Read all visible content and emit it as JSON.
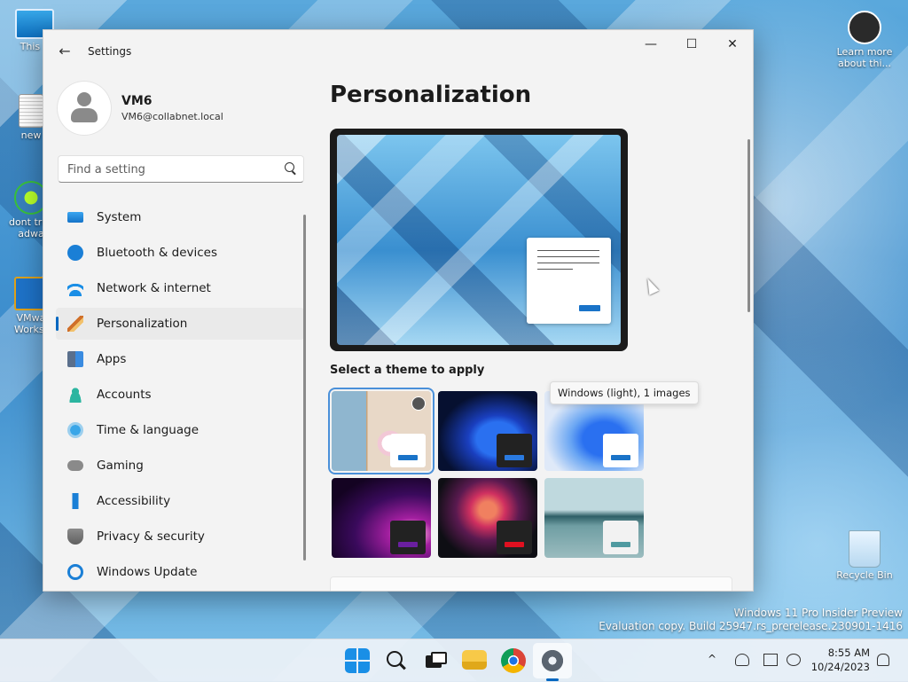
{
  "desktop": {
    "icons": [
      {
        "label": "This P"
      },
      {
        "label": "new"
      },
      {
        "label": "dont trus adwa"
      },
      {
        "label": "VMwa Workst"
      },
      {
        "label": "Learn more about thi..."
      },
      {
        "label": "Recycle Bin"
      }
    ],
    "watermark": {
      "line1": "Windows 11 Pro Insider Preview",
      "line2": "Evaluation copy. Build 25947.rs_prerelease.230901-1416"
    }
  },
  "window": {
    "title": "Settings",
    "controls": {
      "minimize": "—",
      "maximize": "☐",
      "close": "✕"
    },
    "back_glyph": "←"
  },
  "profile": {
    "name": "VM6",
    "email": "VM6@collabnet.local"
  },
  "search": {
    "placeholder": "Find a setting"
  },
  "nav": {
    "items": [
      {
        "label": "System",
        "icon": "system-icon"
      },
      {
        "label": "Bluetooth & devices",
        "icon": "bluetooth-icon"
      },
      {
        "label": "Network & internet",
        "icon": "wifi-icon"
      },
      {
        "label": "Personalization",
        "icon": "brush-icon",
        "active": true
      },
      {
        "label": "Apps",
        "icon": "apps-icon"
      },
      {
        "label": "Accounts",
        "icon": "account-icon"
      },
      {
        "label": "Time & language",
        "icon": "globe-clock-icon"
      },
      {
        "label": "Gaming",
        "icon": "controller-icon"
      },
      {
        "label": "Accessibility",
        "icon": "accessibility-icon"
      },
      {
        "label": "Privacy & security",
        "icon": "shield-icon"
      },
      {
        "label": "Windows Update",
        "icon": "update-icon"
      }
    ]
  },
  "main": {
    "page_title": "Personalization",
    "theme_heading": "Select a theme to apply",
    "tooltip": "Windows (light), 1 images",
    "themes": [
      {
        "name": "theme-spotlight",
        "selected": true
      },
      {
        "name": "theme-windows-dark"
      },
      {
        "name": "theme-windows-light"
      },
      {
        "name": "theme-glow"
      },
      {
        "name": "theme-captured-motion"
      },
      {
        "name": "theme-flow"
      }
    ]
  },
  "taskbar": {
    "tray_chevron": "^",
    "time": "8:55 AM",
    "date": "10/24/2023"
  },
  "colors": {
    "accent": "#0067c0",
    "window_bg": "#f3f3f3"
  }
}
